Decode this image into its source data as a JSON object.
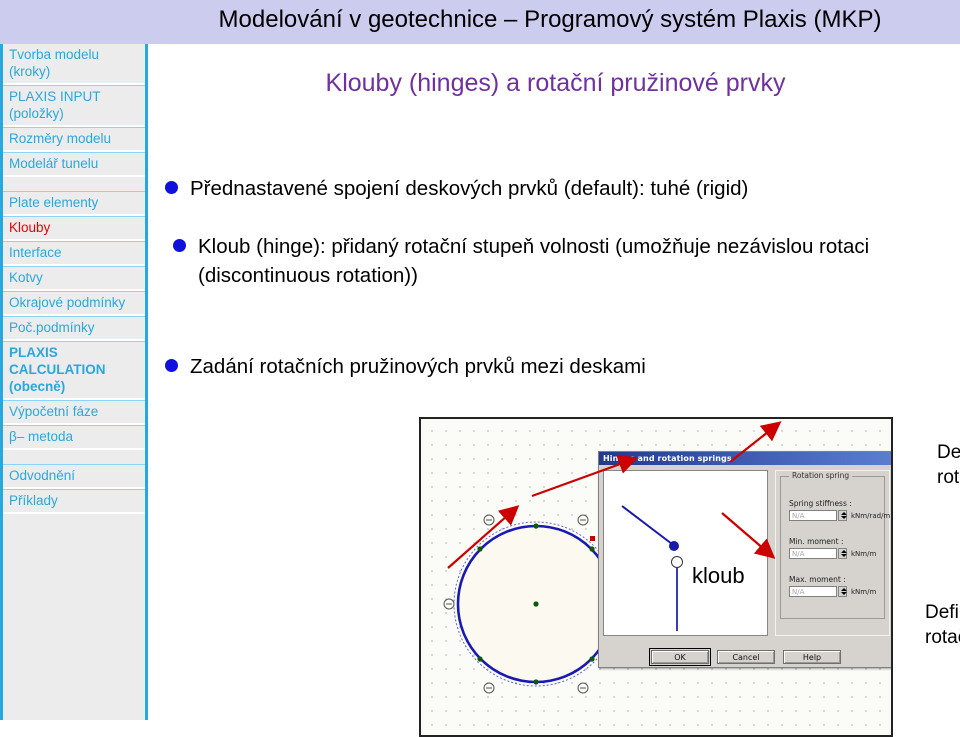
{
  "slide": {
    "title": "Modelování v geotechnice – Programový systém Plaxis (MKP)",
    "heading": "Klouby (hinges) a rotační pružinové prvky",
    "bullets": [
      "Přednastavené spojení deskových prvků (default): tuhé (rigid)",
      "Kloub (hinge): přidaný rotační stupeň volnosti (umožňuje nezávislou rotaci (discontinuous rotation))",
      "Zadání rotačních pružinových prvků mezi deskami"
    ]
  },
  "sidebar": {
    "items": [
      {
        "label": "Tvorba modelu (kroky)",
        "active": false,
        "bold": false
      },
      {
        "label": "PLAXIS INPUT (položky)",
        "active": false,
        "bold": false
      },
      {
        "label": "Rozměry modelu",
        "active": false,
        "bold": false
      },
      {
        "label": "Modelář tunelu",
        "active": false,
        "bold": false
      },
      {
        "label": "Plate elementy",
        "active": false,
        "bold": false
      },
      {
        "label": "Klouby",
        "active": true,
        "bold": false
      },
      {
        "label": "Interface",
        "active": false,
        "bold": false
      },
      {
        "label": "Kotvy",
        "active": false,
        "bold": false
      },
      {
        "label": "Okrajové podmínky",
        "active": false,
        "bold": false
      },
      {
        "label": "Poč.podmínky",
        "active": false,
        "bold": false
      },
      {
        "label": "PLAXIS CALCULATION (obecně)",
        "active": false,
        "bold": true
      },
      {
        "label": "Výpočetní fáze",
        "active": false,
        "bold": false
      },
      {
        "label": "β– metoda",
        "active": false,
        "bold": false
      },
      {
        "label": "Odvodnění",
        "active": false,
        "bold": false
      },
      {
        "label": "Příklady",
        "active": false,
        "bold": false
      }
    ]
  },
  "dialog": {
    "title": "Hinges and rotation springs",
    "canvas_label": "kloub",
    "group_title": "Rotation spring",
    "fields": [
      {
        "label": "Spring stiffness :",
        "value": "N/A",
        "unit": "kNm/rad/m"
      },
      {
        "label": "Min. moment :",
        "value": "N/A",
        "unit": "kNm/m"
      },
      {
        "label": "Max. moment :",
        "value": "N/A",
        "unit": "kNm/m"
      }
    ],
    "buttons": [
      "OK",
      "Cancel",
      "Help"
    ]
  },
  "callouts": {
    "stiffness": "Definování tuhosti rotační pružiny",
    "moment": "Definování momentu rotační pružiny"
  },
  "colors": {
    "title_band": "#ccccee",
    "sidebar_link": "#29a8e0",
    "sidebar_active": "#ee0000",
    "heading": "#7030a0",
    "bullet_dot": "#1111dd",
    "arrow": "#cc0000"
  }
}
